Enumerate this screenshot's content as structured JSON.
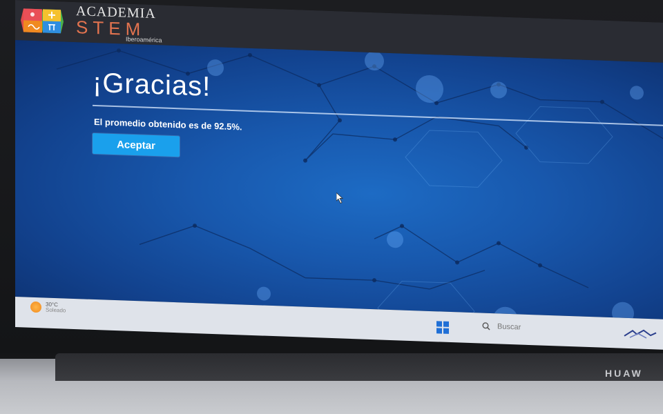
{
  "header": {
    "logo_line1": "ACADEMIA",
    "logo_line2": "STEM",
    "logo_line3": "Iberoamérica"
  },
  "main": {
    "title": "¡Gracias!",
    "message": "El promedio obtenido es de 92.5%.",
    "accept_label": "Aceptar"
  },
  "taskbar": {
    "weather_temp": "30°C",
    "weather_condition": "Soleado",
    "search_label": "Buscar"
  },
  "device": {
    "brand": "HUAW"
  },
  "colors": {
    "accent_button": "#1aa0ec",
    "background_blue": "#1858ad",
    "header_bar": "#2a2c33",
    "logo_orange": "#e2734f",
    "windows_blue": "#1f6fd6"
  },
  "icons": [
    "logo-icon",
    "cursor-icon",
    "sun-icon",
    "windows-start-icon",
    "search-icon",
    "tray-icon"
  ]
}
